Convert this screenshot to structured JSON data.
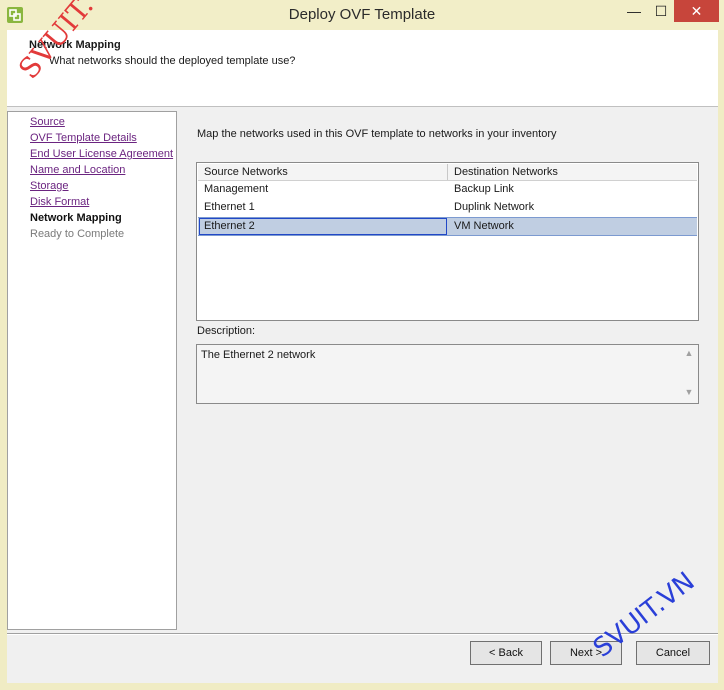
{
  "window": {
    "title": "Deploy OVF Template",
    "minimize_glyph": "—",
    "maximize_glyph": "☐",
    "close_glyph": "✕"
  },
  "header": {
    "title": "Network Mapping",
    "subtitle": "What networks should the deployed template use?"
  },
  "steps": [
    {
      "label": "Source",
      "state": "done"
    },
    {
      "label": "OVF Template Details",
      "state": "done"
    },
    {
      "label": "End User License Agreement",
      "state": "done"
    },
    {
      "label": "Name and Location",
      "state": "done"
    },
    {
      "label": "Storage",
      "state": "done"
    },
    {
      "label": "Disk Format",
      "state": "done"
    },
    {
      "label": "Network Mapping",
      "state": "current"
    },
    {
      "label": "Ready to Complete",
      "state": "future"
    }
  ],
  "content": {
    "instruction": "Map the networks used in this OVF template to networks in your inventory",
    "columns": [
      "Source Networks",
      "Destination Networks"
    ],
    "rows": [
      {
        "source": "Management",
        "destination": "Backup Link"
      },
      {
        "source": "Ethernet 1",
        "destination": "Duplink Network"
      },
      {
        "source": "Ethernet 2",
        "destination": "VM Network"
      }
    ],
    "selected_row": 2,
    "description_label": "Description:",
    "description_text": "The Ethernet 2 network"
  },
  "buttons": {
    "back": "< Back",
    "next": "Next >",
    "cancel": "Cancel"
  },
  "watermark": "SVUIT.VN",
  "colors": {
    "frame": "#f0ecc4",
    "close": "#c7453b",
    "link": "#6b2480",
    "selection": "#c0cee2"
  }
}
